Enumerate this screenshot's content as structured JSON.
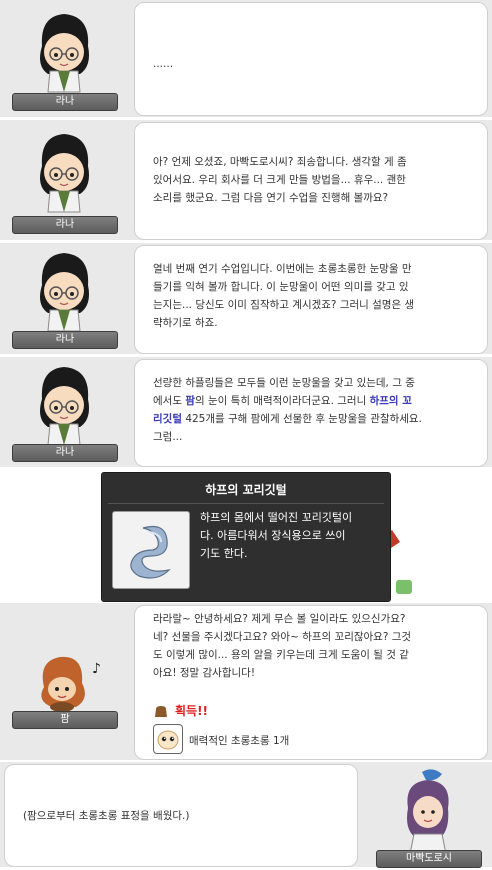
{
  "npc_name": "라나",
  "dialogs": [
    {
      "text": "......"
    },
    {
      "text": "아? 언제 오셨죠, 마빡도로시씨? 죄송합니다. 생각할 게 좀\n있어서요. 우리 회사를 더 크게 만들 방법을... 휴우... 괜한\n소리를 했군요. 그럼 다음 연기 수업을 진행해 볼까요?"
    },
    {
      "text": "열네 번째 연기 수업입니다. 이번에는 초롱초롱한 눈망울 만\n들기를 익혀 볼까 합니다. 이 눈망울이 어떤 의미를 갖고 있\n는지는... 당신도 이미 짐작하고 계시겠죠? 그러니 설명은 생\n략하기로 하죠."
    },
    {
      "text_a": "선량한 하플링들은 모두들 이런 눈망울을 갖고 있는데, 그 중\n에서도 ",
      "hl_1": "팜",
      "text_b": "의 눈이 특히 매력적이라더군요. 그러니 ",
      "hl_2": "하프의 꼬\n리깃털",
      "text_c": " 425개를 구해 팜에게 선물한 후 눈망울을 관찰하세요.\n그럼..."
    }
  ],
  "tooltip": {
    "title": "하프의 꼬리깃털",
    "description": "하프의 몸에서 떨어진 꼬리깃털이\n다. 아름다워서 장식용으로 쓰이\n기도 한다."
  },
  "pam": {
    "name": "팜",
    "text": "라라랄~ 안녕하세요? 제게 무슨 볼 일이라도 있으신가요?\n네? 선물을 주시겠다고요? 와아~ 하프의 꼬리잖아요? 그것\n도 이렇게 많이... 용의 알을 키우는데 크게 도움이 될 것 같\n아요! 정말 감사합니다!",
    "reward_label": "획득!!",
    "reward_item": "매력적인 초롱초롱 1개"
  },
  "player": {
    "name": "마빡도로시",
    "text": "(팜으로부터 초롱초롱 표정을 배웠다.)"
  },
  "colors": {
    "highlight": "#3a3ab8",
    "reward": "#e02020"
  }
}
